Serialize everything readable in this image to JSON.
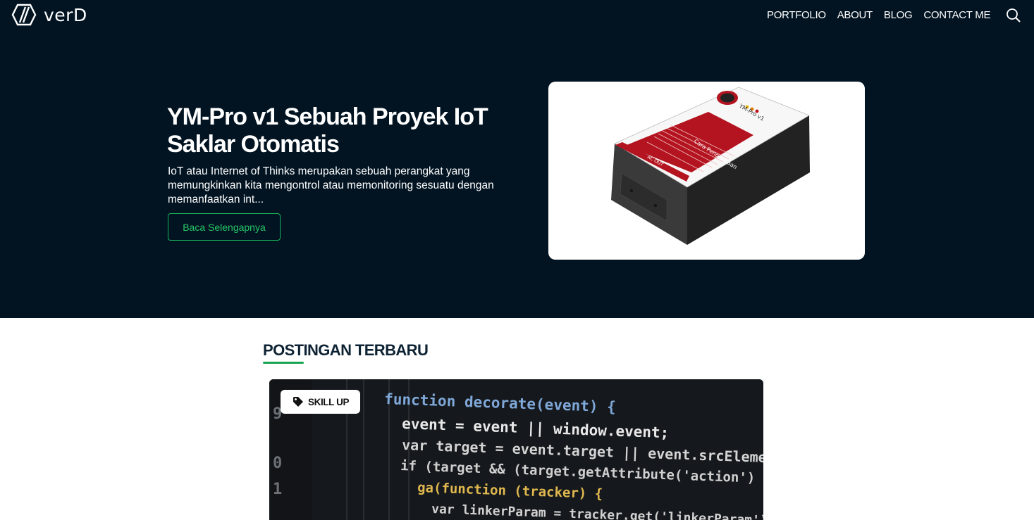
{
  "nav": {
    "logo_text": "verD",
    "menu": [
      {
        "label": "PORTFOLIO"
      },
      {
        "label": "ABOUT"
      },
      {
        "label": "BLOG"
      },
      {
        "label": "CONTACT ME"
      }
    ],
    "search_icon": "search-icon"
  },
  "hero": {
    "title": "YM-Pro v1 Sebuah Proyek IoT Saklar Otomatis",
    "description": "IoT atau Internet of Thinks merupakan sebuah perangkat yang memungkinkan kita mengontrol atau memonitoring sesuatu dengan memanfaatkan int...",
    "button_label": "Baca Selengapnya",
    "image": {
      "device_label": "YM-Pro v1",
      "panel_title": "Cara Penggunaan",
      "strip_label": "AC OUT"
    }
  },
  "latest": {
    "title": "POSTINGAN TERBARU",
    "post": {
      "tag": "SKILL UP",
      "tag_icon": "tag-icon",
      "code_lines": [
        {
          "num": "",
          "text": "function decorate(event) {"
        },
        {
          "num": "9",
          "text": "event = event || window.event;"
        },
        {
          "num": "",
          "text": "var target = event.target || event.srcElement;"
        },
        {
          "num": "0",
          "text": "if (target && (target.getAttribute('action') || target.getAttribute('href')"
        },
        {
          "num": "1",
          "text": "ga(function (tracker) {"
        },
        {
          "num": "",
          "text": "var linkerParam = tracker.get('linkerParam');"
        }
      ]
    }
  },
  "colors": {
    "background_dark": "#021422",
    "accent_green": "#19b35a",
    "text_dark": "#0d2233"
  }
}
